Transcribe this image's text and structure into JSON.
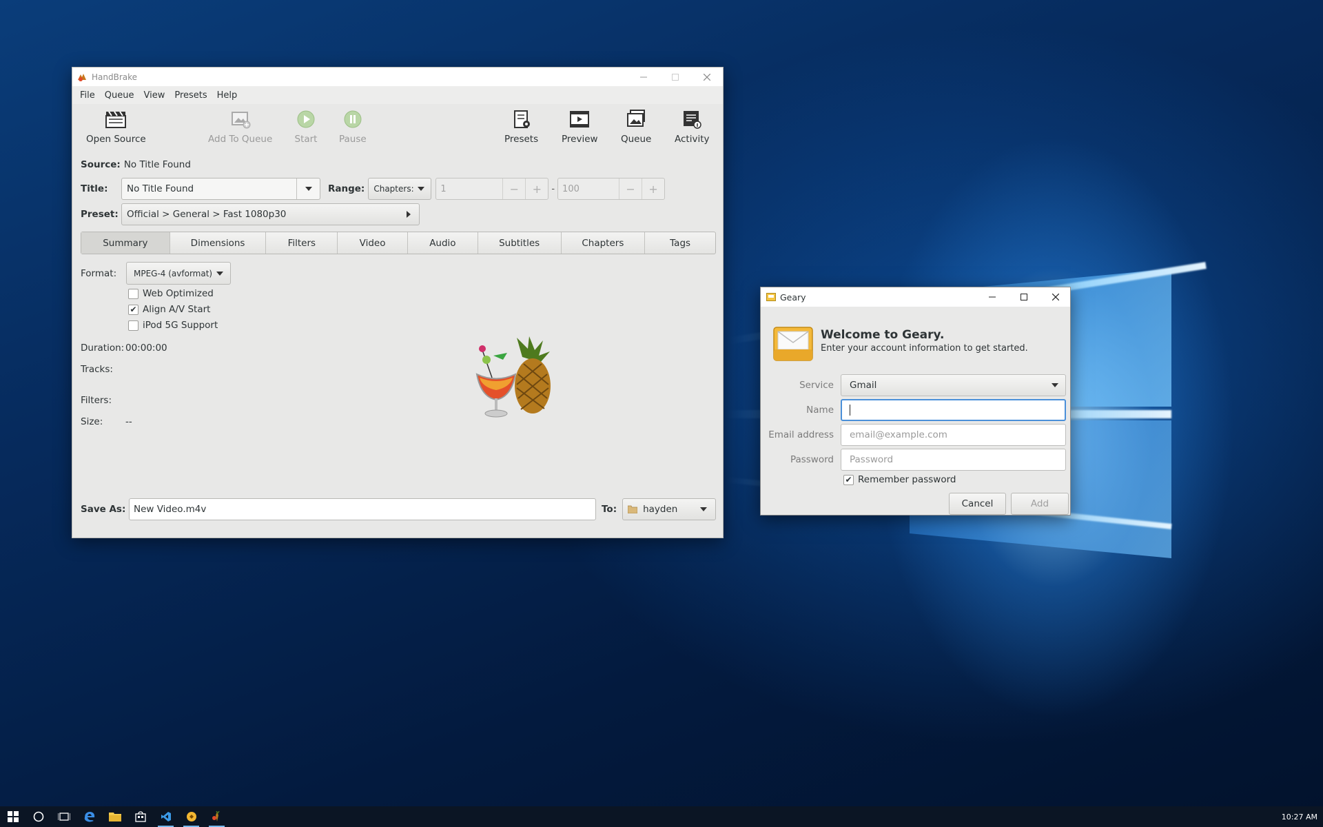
{
  "handbrake": {
    "title": "HandBrake",
    "menu": [
      "File",
      "Queue",
      "View",
      "Presets",
      "Help"
    ],
    "toolbar": {
      "open_source": "Open Source",
      "add_to_queue": "Add To Queue",
      "start": "Start",
      "pause": "Pause",
      "presets": "Presets",
      "preview": "Preview",
      "queue": "Queue",
      "activity": "Activity"
    },
    "source_label": "Source:",
    "source_value": "No Title Found",
    "title_label": "Title:",
    "title_value": "No Title Found",
    "range_label": "Range:",
    "range_mode": "Chapters:",
    "range_start": "1",
    "range_sep": "-",
    "range_end": "100",
    "preset_label": "Preset:",
    "preset_value": "Official > General > Fast 1080p30",
    "tabs": [
      "Summary",
      "Dimensions",
      "Filters",
      "Video",
      "Audio",
      "Subtitles",
      "Chapters",
      "Tags"
    ],
    "active_tab": "Summary",
    "summary": {
      "format_label": "Format:",
      "format_value": "MPEG-4 (avformat)",
      "web_optimized": "Web Optimized",
      "web_optimized_checked": false,
      "align_av": "Align A/V Start",
      "align_av_checked": true,
      "ipod": "iPod 5G Support",
      "ipod_checked": false,
      "duration_label": "Duration:",
      "duration_value": "00:00:00",
      "tracks_label": "Tracks:",
      "filters_label": "Filters:",
      "size_label": "Size:",
      "size_value": "--"
    },
    "save_as_label": "Save As:",
    "save_as_value": "New Video.m4v",
    "to_label": "To:",
    "to_value": "hayden"
  },
  "geary": {
    "title": "Geary",
    "welcome": "Welcome to Geary.",
    "subtitle": "Enter your account information to get started.",
    "service_label": "Service",
    "service_value": "Gmail",
    "name_label": "Name",
    "email_label": "Email address",
    "email_placeholder": "email@example.com",
    "password_label": "Password",
    "password_placeholder": "Password",
    "remember": "Remember password",
    "remember_checked": true,
    "cancel": "Cancel",
    "add": "Add"
  },
  "taskbar": {
    "clock": "10:27 AM"
  },
  "colors": {
    "accent_focus": "#4a90d9",
    "taskbar": "#0b1524"
  }
}
